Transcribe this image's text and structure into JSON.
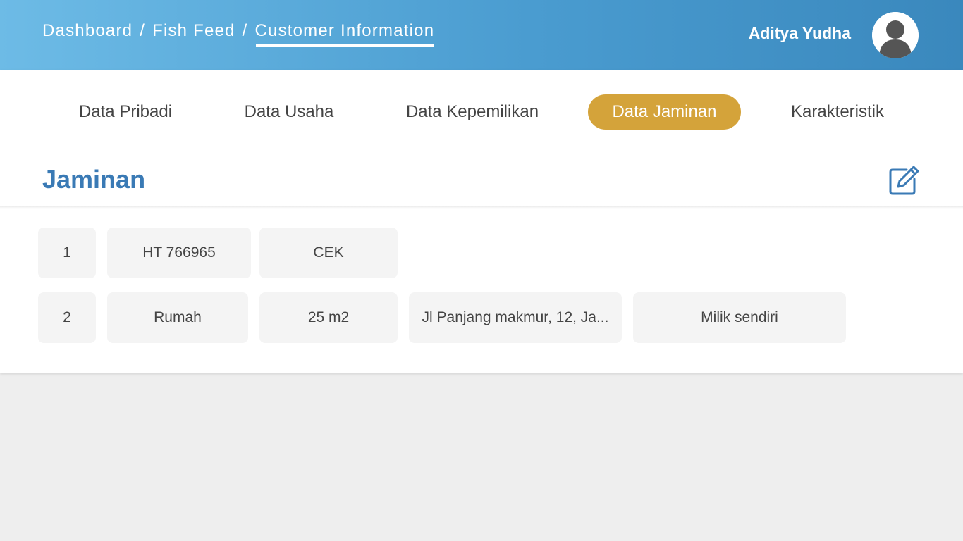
{
  "header": {
    "breadcrumb": [
      "Dashboard",
      "Fish Feed",
      "Customer Information"
    ],
    "separator": "/",
    "user_name": "Aditya Yudha",
    "avatar_icon": "user-avatar-icon",
    "gradient_colors": [
      "#6dbbe6",
      "#3a88bd"
    ]
  },
  "tabs": [
    {
      "label": "Data Pribadi",
      "active": false
    },
    {
      "label": "Data Usaha",
      "active": false
    },
    {
      "label": "Data Kepemilikan",
      "active": false
    },
    {
      "label": "Data Jaminan",
      "active": true
    },
    {
      "label": "Karakteristik",
      "active": false
    }
  ],
  "active_tab_color": "#d4a33a",
  "section": {
    "title": "Jaminan",
    "edit_icon": "edit-icon",
    "title_color": "#3a7ab5"
  },
  "rows": [
    {
      "cells": [
        "1",
        "HT 766965",
        "CEK"
      ]
    },
    {
      "cells": [
        "2",
        "Rumah",
        "25 m2",
        "Jl Panjang makmur, 12, Ja...",
        "Milik sendiri"
      ]
    }
  ]
}
